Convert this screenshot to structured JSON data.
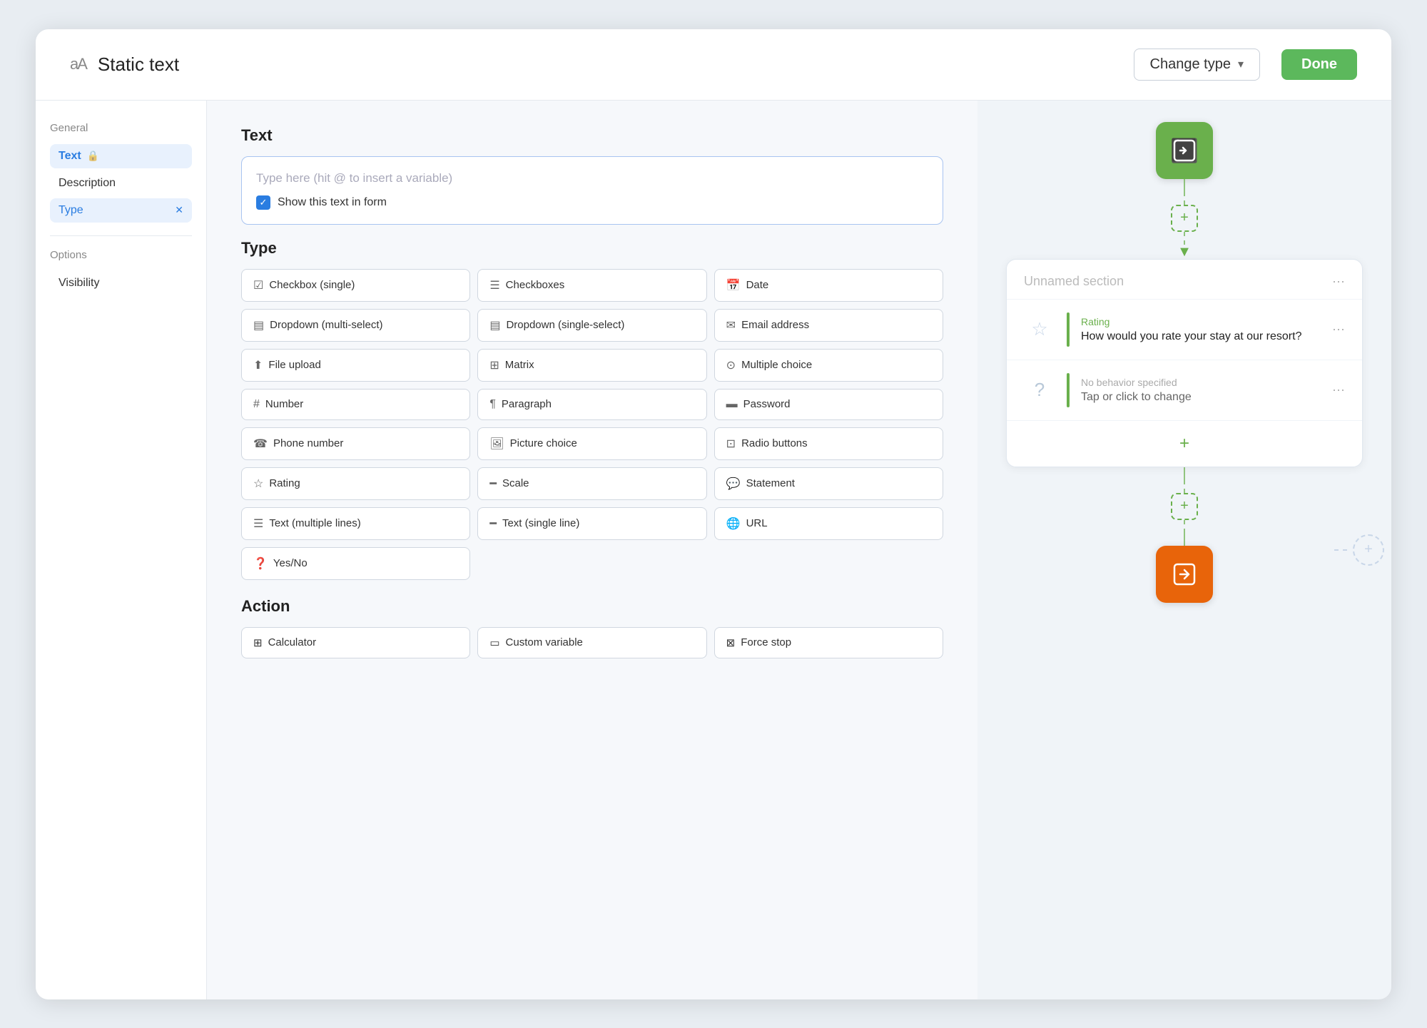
{
  "header": {
    "icon": "aA",
    "title": "Static text",
    "change_type_label": "Change type",
    "done_label": "Done"
  },
  "sidebar": {
    "general_label": "General",
    "text_item_label": "Text",
    "lock_icon": "🔒",
    "description_label": "Description",
    "type_item_label": "Type",
    "x_icon": "✕",
    "options_label": "Options",
    "visibility_label": "Visibility"
  },
  "content": {
    "text_section_title": "Text",
    "text_placeholder": "Type here (hit @ to insert a variable)",
    "show_form_label": "Show this text in form",
    "type_section_title": "Type",
    "type_items": [
      {
        "icon": "☑",
        "label": "Checkbox (single)"
      },
      {
        "icon": "☰",
        "label": "Checkboxes"
      },
      {
        "icon": "📅",
        "label": "Date"
      },
      {
        "icon": "▦",
        "label": "Dropdown (multi-select)"
      },
      {
        "icon": "▤",
        "label": "Dropdown (single-select)"
      },
      {
        "icon": "✉",
        "label": "Email address"
      },
      {
        "icon": "⬆",
        "label": "File upload"
      },
      {
        "icon": "⊞",
        "label": "Matrix"
      },
      {
        "icon": "⊙",
        "label": "Multiple choice"
      },
      {
        "icon": "🔢",
        "label": "Number"
      },
      {
        "icon": "¶",
        "label": "Paragraph"
      },
      {
        "icon": "▬",
        "label": "Password"
      },
      {
        "icon": "☎",
        "label": "Phone number"
      },
      {
        "icon": "🖼",
        "label": "Picture choice"
      },
      {
        "icon": "⊡",
        "label": "Radio buttons"
      },
      {
        "icon": "☆",
        "label": "Rating"
      },
      {
        "icon": "▬",
        "label": "Scale"
      },
      {
        "icon": "💬",
        "label": "Statement"
      },
      {
        "icon": "☰",
        "label": "Text (multiple lines)"
      },
      {
        "icon": "▬",
        "label": "Text (single line)"
      },
      {
        "icon": "🌐",
        "label": "URL"
      },
      {
        "icon": "❓",
        "label": "Yes/No"
      }
    ],
    "action_section_title": "Action",
    "action_items": [
      {
        "icon": "⊞",
        "label": "Calculator"
      },
      {
        "icon": "▭",
        "label": "Custom variable"
      },
      {
        "icon": "⊠",
        "label": "Force stop"
      }
    ]
  },
  "flow": {
    "entry_icon": "⊕",
    "exit_icon": "⊖",
    "section_title": "Unnamed section",
    "rating_label": "Rating",
    "rating_question": "How would you rate your stay at our resort?",
    "no_behavior_label": "No behavior specified",
    "no_behavior_sub": "Tap or click to change",
    "add_icon": "+",
    "section_menu": "···"
  },
  "colors": {
    "green": "#6ab04c",
    "orange": "#e8640a",
    "blue": "#2a7de1",
    "light_blue_bg": "#e8f1fd"
  }
}
